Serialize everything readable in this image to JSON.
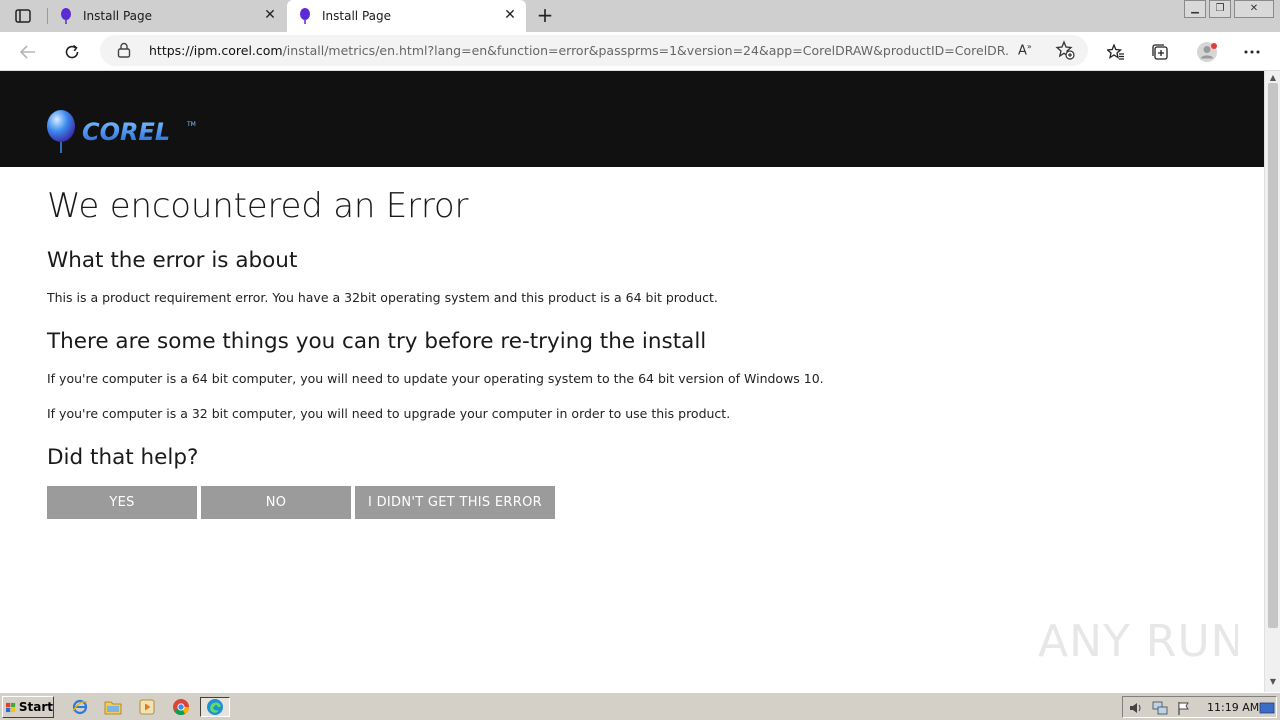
{
  "browser": {
    "tabs": [
      {
        "title": "Install Page",
        "active": false
      },
      {
        "title": "Install Page",
        "active": true
      }
    ],
    "url_host": "https://ipm.corel.com",
    "url_rest": "/install/metrics/en.html?lang=en&function=error&passprms=1&version=24&app=CorelDRAW&productID=CorelDR...",
    "read_aloud_label": "A̅ʼ"
  },
  "page": {
    "brand": "COREL",
    "trademark": "TM",
    "title": "We encountered an Error",
    "section1_heading": "What the error is about",
    "section1_text": "This is a product requirement error. You have a 32bit operating system and this product is a 64 bit product.",
    "section2_heading": "There are some things you can try before re-trying the install",
    "section2_text1": "If you're computer is a 64 bit computer, you will need to update your operating system to the 64 bit version of Windows 10.",
    "section2_text2": "If you're computer is a 32 bit computer, you will need to upgrade your computer in order to use this product.",
    "help_heading": "Did that help?",
    "buttons": {
      "yes": "YES",
      "no": "NO",
      "not_mine": "I DIDN'T GET THIS ERROR"
    }
  },
  "watermark": "ANY RUN",
  "taskbar": {
    "start_label": "Start",
    "clock": "11:19 AM"
  },
  "colors": {
    "brand_bar": "#111111",
    "button_bg": "#9b9b9b",
    "tab_favicon": "#5b2bd6"
  }
}
